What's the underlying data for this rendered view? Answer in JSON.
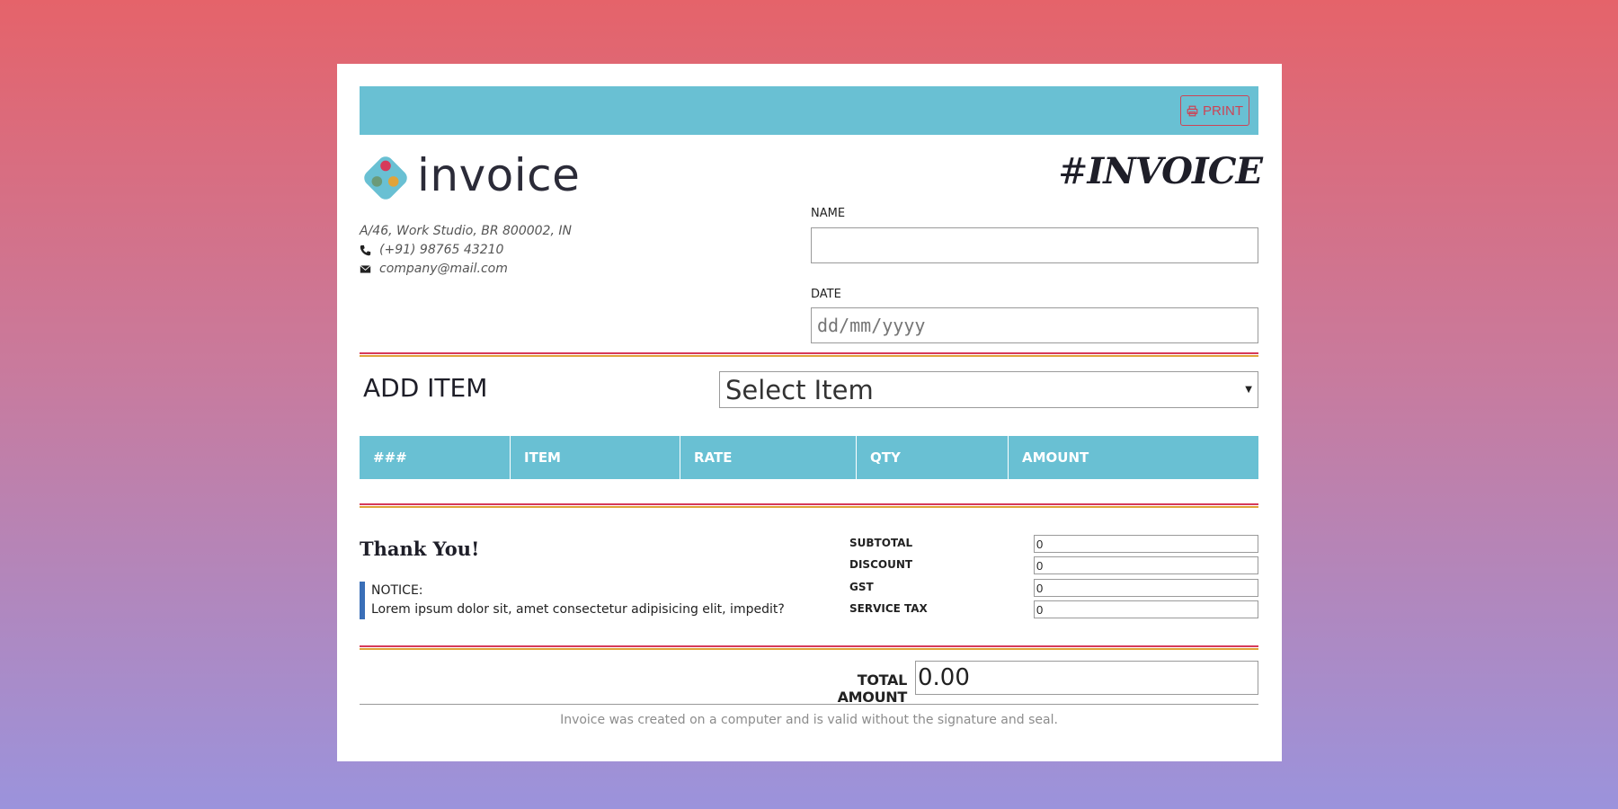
{
  "toolbar": {
    "print_label": "PRINT"
  },
  "brand": {
    "logo_text": "invoice",
    "title_hash": "#",
    "title_word": "INVOICE"
  },
  "company": {
    "address": "A/46, Work Studio, BR 800002, IN",
    "phone": "(+91) 98765 43210",
    "email": "company@mail.com"
  },
  "form": {
    "name_label": "NAME",
    "name_value": "",
    "date_label": "DATE",
    "date_placeholder": "dd/mm/yyyy"
  },
  "add_item": {
    "heading": "ADD ITEM",
    "select_value": "Select Item"
  },
  "table": {
    "headers": [
      "###",
      "ITEM",
      "RATE",
      "QTY",
      "AMOUNT"
    ]
  },
  "footer": {
    "thanks": "Thank You!",
    "notice_title": "NOTICE:",
    "notice_text": "Lorem ipsum dolor sit, amet consectetur adipisicing elit, impedit?",
    "validity_note": "Invoice was created on a computer and is valid without the signature and seal."
  },
  "summary": [
    {
      "label": "SUBTOTAL",
      "value": "0"
    },
    {
      "label": "DISCOUNT",
      "value": "0"
    },
    {
      "label": "GST",
      "value": "0"
    },
    {
      "label": "SERVICE TAX",
      "value": "0"
    }
  ],
  "total": {
    "label": "TOTAL AMOUNT",
    "value": "0.00"
  },
  "colors": {
    "accent": "#69c0d3",
    "print": "#cc4456",
    "line_red": "#d63a5a",
    "line_gold": "#e0a33a",
    "notice_bar": "#3a6fb8"
  }
}
